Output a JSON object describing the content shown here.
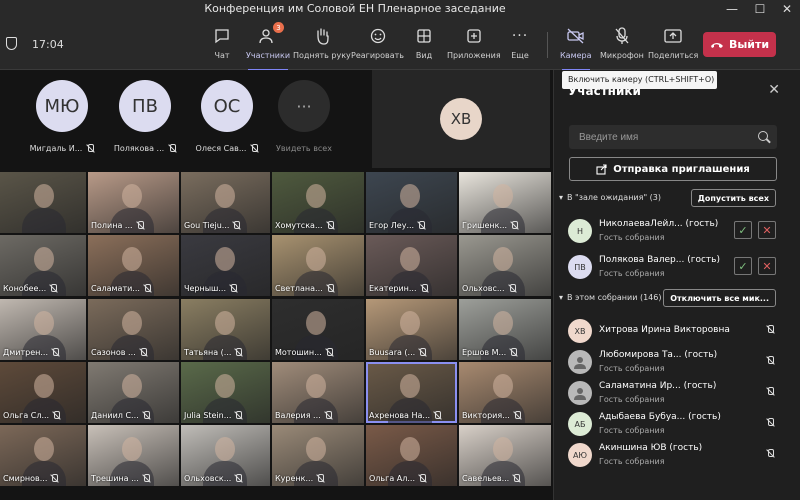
{
  "window": {
    "title": "Конференция им Соловой ЕН Пленарное заседание",
    "minimize": "—",
    "maximize": "☐",
    "close": "✕"
  },
  "toolbar": {
    "time": "17:04",
    "chat": "Чат",
    "participants": "Участники",
    "participants_badge": "3",
    "raise_hand": "Поднять руку",
    "react": "Реагировать",
    "view": "Вид",
    "apps": "Приложения",
    "more": "Еще",
    "camera": "Камера",
    "mic": "Микрофон",
    "share": "Поделиться",
    "leave": "Выйти"
  },
  "tooltip": "Включить камеру (CTRL+SHIFT+O)",
  "stage": {
    "top_avatars": [
      {
        "initials": "МЮ",
        "name": "Мигдаль И..."
      },
      {
        "initials": "ПВ",
        "name": "Полякова ..."
      },
      {
        "initials": "ОС",
        "name": "Олеся Сав..."
      }
    ],
    "see_all_icon": "···",
    "see_all": "Увидеть всех",
    "featured_initials": "ХВ",
    "tiles": [
      {
        "name": "",
        "color": "#5a5548"
      },
      {
        "name": "Полина ...",
        "color": "#b89a88"
      },
      {
        "name": "Gou Tieju...",
        "color": "#7a6d5e"
      },
      {
        "name": "Хомутска...",
        "color": "#4f5a3e"
      },
      {
        "name": "Егор Леу...",
        "color": "#3d4650"
      },
      {
        "name": "Гришенк...",
        "color": "#e8e4dc"
      },
      {
        "name": "Конобее...",
        "color": "#6d6a64"
      },
      {
        "name": "Саламати...",
        "color": "#8b6f5a"
      },
      {
        "name": "Черныш...",
        "color": "#3a3a40"
      },
      {
        "name": "Светлана...",
        "color": "#a89270"
      },
      {
        "name": "Екатерин...",
        "color": "#6a5a58"
      },
      {
        "name": "Ольховс...",
        "color": "#9a9890"
      },
      {
        "name": "Дмитрен...",
        "color": "#c0b8b0"
      },
      {
        "name": "Сазонов ...",
        "color": "#7b6b5b"
      },
      {
        "name": "Татьяна (...",
        "color": "#8a7e62"
      },
      {
        "name": "Мотошин...",
        "color": "#2e2e2e"
      },
      {
        "name": "Buusara (...",
        "color": "#b59878"
      },
      {
        "name": "Ершов М...",
        "color": "#9d9f9a"
      },
      {
        "name": "Ольга Сл...",
        "color": "#5e4a3a"
      },
      {
        "name": "Даниил С...",
        "color": "#807a72"
      },
      {
        "name": "Julia Stein...",
        "color": "#5a6a4a"
      },
      {
        "name": "Валерия ...",
        "color": "#a08c7a"
      },
      {
        "name": "Ахренова На...",
        "color": "#6a5a48"
      },
      {
        "name": "Виктория...",
        "color": "#a88a70"
      },
      {
        "name": "Смирнов...",
        "color": "#7c6858"
      },
      {
        "name": "Трешина ...",
        "color": "#c8c0b8"
      },
      {
        "name": "Ольховск...",
        "color": "#c0bdb8"
      },
      {
        "name": "Куренк...",
        "color": "#9a8a78"
      },
      {
        "name": "Ольга Ал...",
        "color": "#7a5a48"
      },
      {
        "name": "Савельев...",
        "color": "#d8d0c8"
      }
    ]
  },
  "panel": {
    "title": "Участники",
    "close": "✕",
    "search_placeholder": "Введите имя",
    "invite": "Отправка приглашения",
    "lobby": {
      "header": "В \"зале ожидания\" (3)",
      "admit_all": "Допустить всех"
    },
    "lobby_people": [
      {
        "initials": "Н",
        "name": "НиколаеваЛейл... (гость)",
        "role": "Гость собрания",
        "color": "#dcebd5"
      },
      {
        "initials": "ПВ",
        "name": "Полякова Валер... (гость)",
        "role": "Гость собрания",
        "color": "#dcdcf0"
      }
    ],
    "meeting": {
      "header": "В этом собрании (146)",
      "mute_all": "Отключить все мик..."
    },
    "meeting_people": [
      {
        "initials": "ХВ",
        "name": "Хитрова Ирина Викторовна",
        "role": "",
        "color": "#f0d8cc"
      },
      {
        "initials": "",
        "name": "Любомирова Та... (гость)",
        "role": "Гость собрания",
        "color": "#b8b8b8"
      },
      {
        "initials": "",
        "name": "Саламатина Ир... (гость)",
        "role": "Гость собрания",
        "color": "#b8b8b8"
      },
      {
        "initials": "АБ",
        "name": "Адыбаева Бубуа... (гость)",
        "role": "Гость собрания",
        "color": "#dcebd5"
      },
      {
        "initials": "АЮ",
        "name": "Акиншина ЮВ (гость)",
        "role": "Гость собрания",
        "color": "#f0d8cc"
      }
    ]
  },
  "colors": {
    "accent": "#7f85f5",
    "leave": "#c4314b",
    "badge": "#e96f4c"
  }
}
